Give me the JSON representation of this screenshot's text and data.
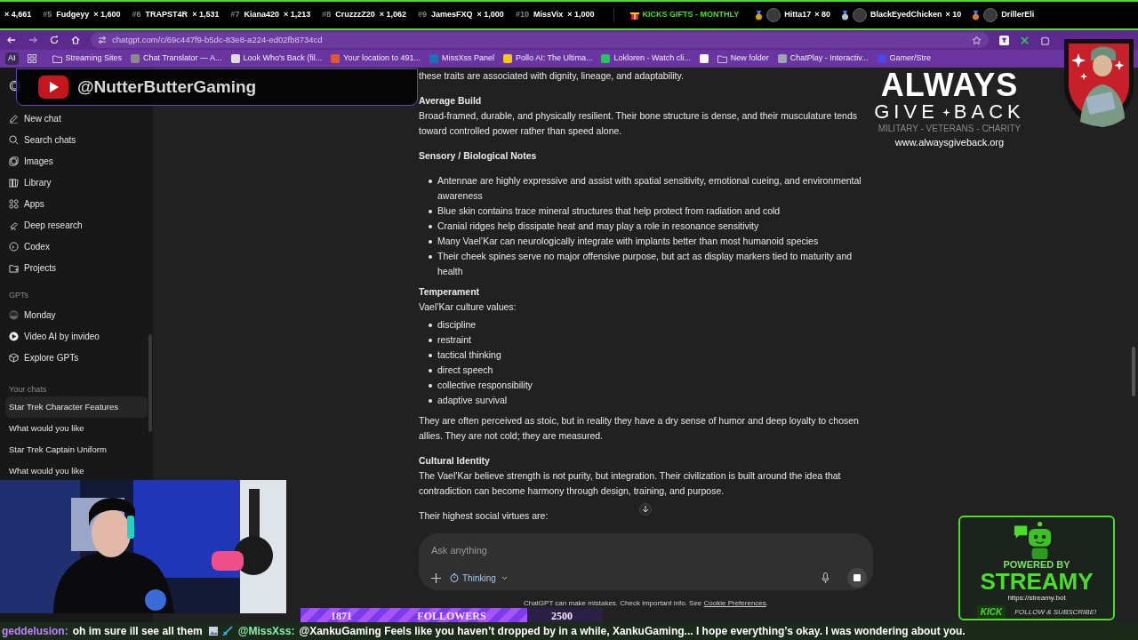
{
  "leaderboard": {
    "entries": [
      {
        "count": "× 4,661"
      },
      {
        "rank": "#5",
        "name": "Fudgeyy",
        "count": "× 1,600"
      },
      {
        "rank": "#6",
        "name": "TRAPST4R",
        "count": "× 1,531"
      },
      {
        "rank": "#7",
        "name": "Kiana420",
        "count": "× 1,213"
      },
      {
        "rank": "#8",
        "name": "CruzzzZ20",
        "count": "× 1,062"
      },
      {
        "rank": "#9",
        "name": "JamesFXQ",
        "count": "× 1,000"
      },
      {
        "rank": "#10",
        "name": "MissVix",
        "count": "× 1,000"
      }
    ],
    "gifts_title": "KICKS GIFTS - MONTHLY",
    "gifters": [
      {
        "name": "Hitta17",
        "count": "× 80",
        "color": "#d4a017"
      },
      {
        "name": "BlackEyedChicken",
        "count": "× 10",
        "color": "#b8c0c8"
      },
      {
        "name": "DrillerEli",
        "color": "#cd7f32"
      }
    ]
  },
  "browser": {
    "url": "chatgpt.com/c/69c447f9-b5dc-83e8-a224-ed02fb8734cd",
    "ai_label": "AI",
    "bookmarks": [
      {
        "kind": "folder",
        "label": "Streaming Sites"
      },
      {
        "kind": "site",
        "label": "Chat Translator — A..."
      },
      {
        "kind": "site",
        "label": "Look Who's Back (fil..."
      },
      {
        "kind": "site",
        "label": "Your location to 491..."
      },
      {
        "kind": "site",
        "label": "MissXss Panel"
      },
      {
        "kind": "site",
        "label": "Pollo AI: The Ultima..."
      },
      {
        "kind": "site",
        "label": "Lokloren - Watch cli..."
      },
      {
        "kind": "site"
      },
      {
        "kind": "folder",
        "label": "New folder"
      },
      {
        "kind": "site",
        "label": "ChatPlay - Interactiv..."
      },
      {
        "kind": "site",
        "label": "Gamer/Stre"
      }
    ]
  },
  "channel_overlay": {
    "handle": "@NutterButterGaming"
  },
  "chatgpt": {
    "sidebar": {
      "items": [
        {
          "label": "New chat"
        },
        {
          "label": "Search chats"
        },
        {
          "label": "Images"
        },
        {
          "label": "Library"
        },
        {
          "label": "Apps"
        },
        {
          "label": "Deep research"
        },
        {
          "label": "Codex"
        },
        {
          "label": "Projects"
        }
      ],
      "gpts_heading": "GPTs",
      "gpts": [
        {
          "label": "Monday"
        },
        {
          "label": "Video AI by invideo"
        },
        {
          "label": "Explore GPTs"
        }
      ],
      "chats_heading": "Your chats",
      "chats": [
        {
          "label": "Star Trek Character Features",
          "selected": true
        },
        {
          "label": "What would you like",
          "selected": false
        },
        {
          "label": "Star Trek Captain Uniform",
          "selected": false
        },
        {
          "label": "What would you like",
          "selected": false
        }
      ]
    },
    "blocks": [
      {
        "kind": "paragraph",
        "text": "these traits are associated with dignity, lineage, and adaptability."
      },
      {
        "kind": "heading",
        "text": "Average Build"
      },
      {
        "kind": "paragraph",
        "text": "Broad-framed, durable, and physically resilient. Their bone structure is dense, and their musculature tends toward controlled power rather than speed alone."
      },
      {
        "kind": "heading",
        "text": "Sensory / Biological Notes"
      },
      {
        "kind": "list",
        "items": [
          "Antennae are highly expressive and assist with spatial sensitivity, emotional cueing, and environmental awareness",
          "Blue skin contains trace mineral structures that help protect from radiation and cold",
          "Cranial ridges help dissipate heat and may play a role in resonance sensitivity",
          "Many Vael’Kar can neurologically integrate with implants better than most humanoid species",
          "Their cheek spines serve no major offensive purpose, but act as display markers tied to maturity and health"
        ]
      },
      {
        "kind": "heading",
        "text": "Temperament"
      },
      {
        "kind": "paragraph",
        "text": "Vael’Kar culture values:"
      },
      {
        "kind": "list",
        "items": [
          "discipline",
          "restraint",
          "tactical thinking",
          "direct speech",
          "collective responsibility",
          "adaptive survival"
        ]
      },
      {
        "kind": "paragraph",
        "text": "They are often perceived as stoic, but in reality they have a dry sense of humor and deep loyalty to chosen allies. They are not cold; they are measured."
      },
      {
        "kind": "heading",
        "text": "Cultural Identity"
      },
      {
        "kind": "paragraph",
        "text": "The Vael’Kar believe strength is not purity, but integration. Their civilization is built around the idea that contradiction can become harmony through design, training, and purpose."
      },
      {
        "kind": "paragraph",
        "text": "Their highest social virtues are:"
      }
    ],
    "composer": {
      "placeholder": "Ask anything",
      "mode": "Thinking"
    },
    "disclaimer": "ChatGPT can make mistakes. Check important info. See",
    "disclaimer_link": "Cookie Preferences",
    "disclaimer_end": "."
  },
  "sponsor": {
    "line1": "ALWAYS",
    "line2a": "GIVE",
    "line2b": "BACK",
    "tagline": "MILITARY - VETERANS - CHARITY",
    "url": "www.alwaysgiveback.org"
  },
  "follower_goal": {
    "current": "1871",
    "label": "FOLLOWERS",
    "goal": "2500",
    "level": 0.75
  },
  "streamy": {
    "powered": "POWERED BY",
    "name": "STREAMY",
    "url": "https://streamy.bot",
    "platform": "KICK",
    "cta": "FOLLOW & SUBSCRIBE!"
  },
  "ticker": [
    {
      "user": "geddelusion:",
      "message": "oh im sure ill see all them",
      "color": "#c084fc"
    },
    {
      "user": "@MissXss:",
      "message": "@XankuGaming Feels like you haven’t dropped by in a while, XankuGaming... I hope everything’s okay. I was wondering about you.",
      "color": "#86efac"
    }
  ]
}
